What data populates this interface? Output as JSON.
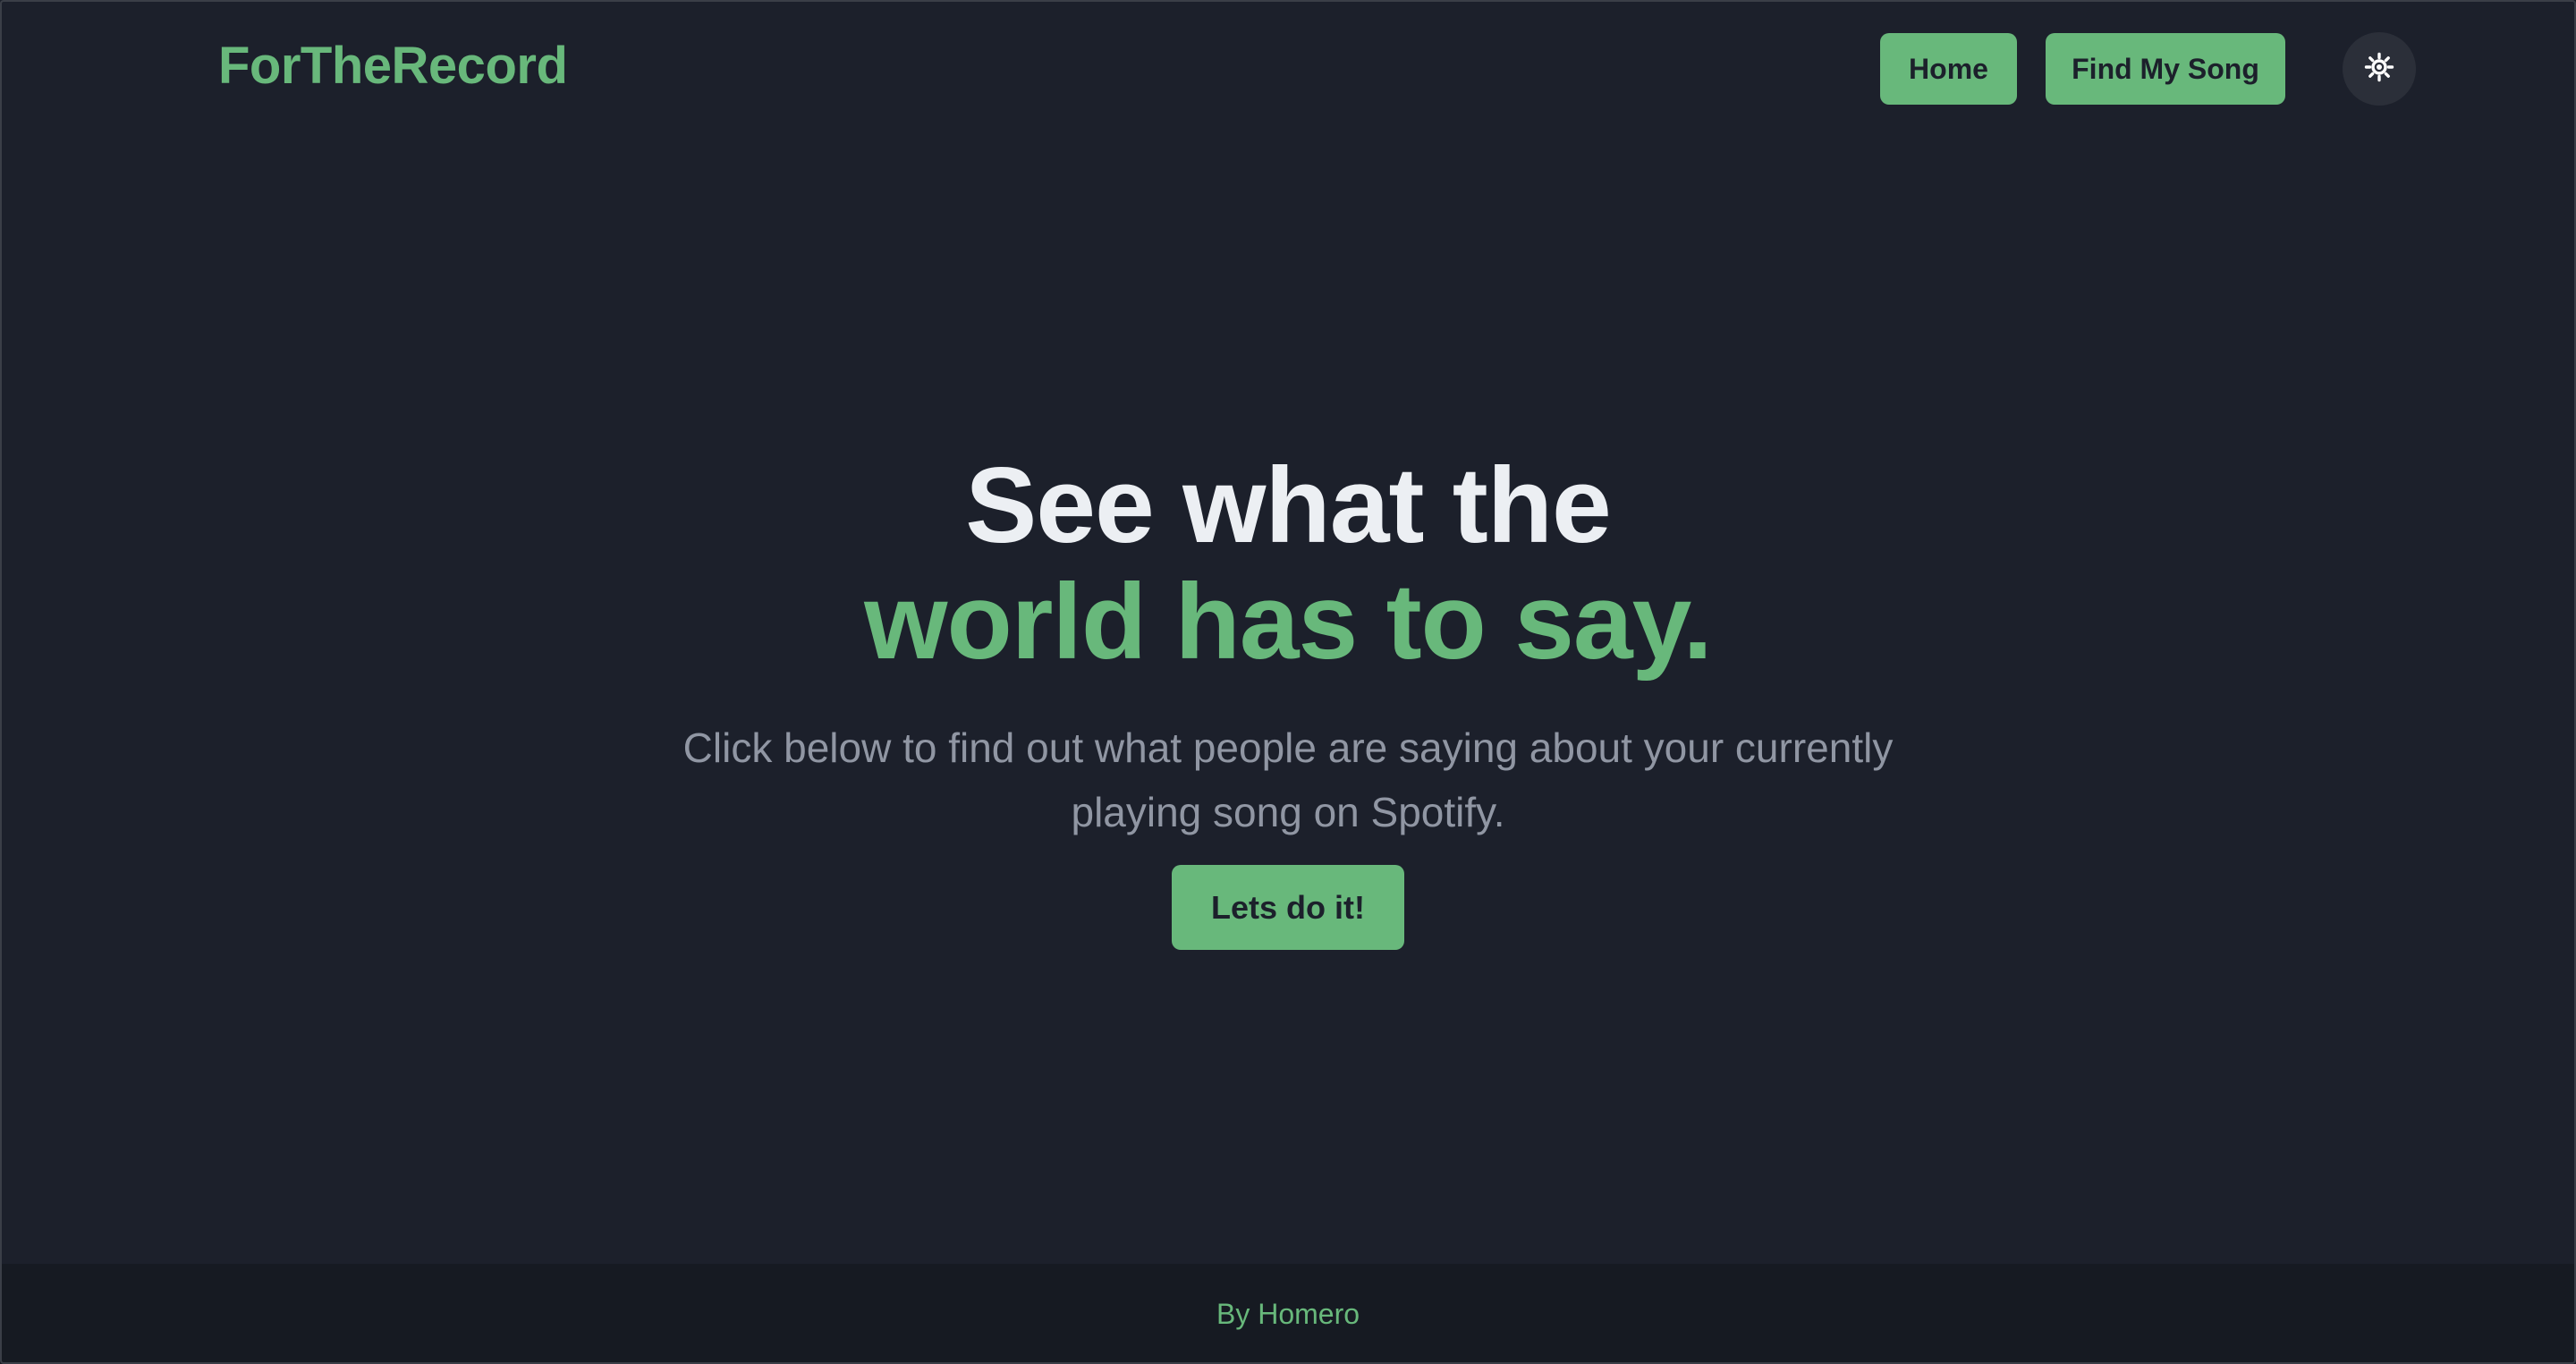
{
  "header": {
    "brand": "ForTheRecord",
    "nav": {
      "home_label": "Home",
      "find_label": "Find My Song"
    },
    "theme_toggle_icon": "sun-icon"
  },
  "hero": {
    "title_line1": "See what the",
    "title_line2": "world has to say.",
    "subtitle": "Click below to find out what people are saying about your currently playing song on Spotify.",
    "cta_label": "Lets do it!"
  },
  "footer": {
    "credit": "By Homero"
  },
  "colors": {
    "background": "#1c202b",
    "accent": "#68b87b",
    "footer_bg": "#161a22",
    "heading": "#eceff3",
    "muted_text": "#9096a3"
  }
}
